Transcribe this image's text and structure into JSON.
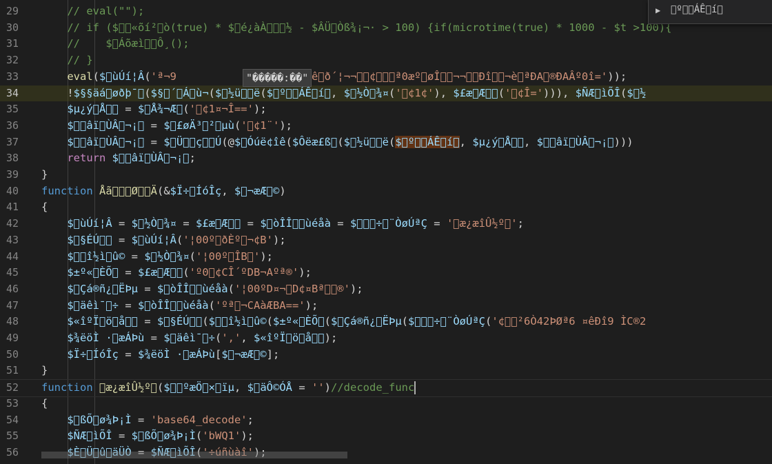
{
  "editor": {
    "lines": [
      {
        "n": "29",
        "segs": [
          {
            "c": "c-comment",
            "t": "    // eval(\"\");"
          }
        ]
      },
      {
        "n": "30",
        "segs": [
          {
            "c": "c-comment",
            "t": "    // if ($\u0000\u0000«õí²\u0000ò(true) * $\u0000é¿àÀ\u0000\u0000\u0000½ - $ÂÜ\u0000Òß¾¡¬· > 100) {if(microtime(true) * 1000 - $t >100){"
          }
        ]
      },
      {
        "n": "31",
        "segs": [
          {
            "c": "c-comment",
            "t": "    //    $\u0000Áõæì\u0000\u0000Ô¸();"
          }
        ]
      },
      {
        "n": "32",
        "segs": [
          {
            "c": "c-comment",
            "t": "    // }"
          }
        ]
      },
      {
        "n": "33",
        "segs": [
          {
            "c": "c-fn",
            "t": "    eval"
          },
          {
            "c": "c-plain",
            "t": "("
          },
          {
            "c": "c-var",
            "t": "$\u0000ùÚí¦Â"
          },
          {
            "c": "c-plain",
            "t": "("
          },
          {
            "c": "c-str",
            "t": "'ª¬9"
          },
          {
            "c": "c-str",
            "t": "               3B0ÈÔêê\u0000ð´¦¬¬\u0000\u0000¢\u0000\u0000\u0000ª0æº\u0000øÎ\u0000\u0000¬¬\u0000\u0000Ðî\u0000\u0000¬è\u0000ªÐA\u0000®ÐAÂº0î='"
          },
          {
            "c": "c-plain",
            "t": "));"
          }
        ]
      },
      {
        "n": "34",
        "segs": [
          {
            "c": "c-plain",
            "t": "    !"
          },
          {
            "c": "c-var",
            "t": "$§§äá\u0000øðþ¯\u0000"
          },
          {
            "c": "c-plain",
            "t": "("
          },
          {
            "c": "c-var",
            "t": "$§\u0000´\u0000Á\u0000ù¬"
          },
          {
            "c": "c-plain",
            "t": "("
          },
          {
            "c": "c-var",
            "t": "$\u0000½ü\u0000\u0000ë"
          },
          {
            "c": "c-plain",
            "t": "("
          },
          {
            "c": "c-var",
            "t": "$\u0000º\u0000\u0000ÁÊ\u0000í\u0000"
          },
          {
            "c": "c-plain",
            "t": ", "
          },
          {
            "c": "c-var",
            "t": "$\u0000½Ò\u0000¾¤"
          },
          {
            "c": "c-plain",
            "t": "("
          },
          {
            "c": "c-str",
            "t": "'\u0000¢1¢'"
          },
          {
            "c": "c-plain",
            "t": "), "
          },
          {
            "c": "c-var",
            "t": "$£æ\u0000Æ\u0000\u0000"
          },
          {
            "c": "c-plain",
            "t": "("
          },
          {
            "c": "c-str",
            "t": "'\u0000¢Î='"
          },
          {
            "c": "c-plain",
            "t": "))), "
          },
          {
            "c": "c-var",
            "t": "$ÑÆ\u0000ìÕÎ"
          },
          {
            "c": "c-plain",
            "t": "("
          },
          {
            "c": "c-var",
            "t": "$\u0000½"
          }
        ]
      },
      {
        "n": "35",
        "segs": [
          {
            "c": "c-var",
            "t": "    $µ¿ý\u0000Å\u0000\u0000"
          },
          {
            "c": "c-plain",
            "t": " = "
          },
          {
            "c": "c-var",
            "t": "$\u0000Å¾¬Æ\u0000"
          },
          {
            "c": "c-plain",
            "t": "("
          },
          {
            "c": "c-str",
            "t": "'\u0000¢1¤¬Î=='"
          },
          {
            "c": "c-plain",
            "t": ");"
          }
        ]
      },
      {
        "n": "36",
        "segs": [
          {
            "c": "c-var",
            "t": "    $\u0000\u0000âï\u0000ÙÂ\u0000¬¡\u0000"
          },
          {
            "c": "c-plain",
            "t": " = "
          },
          {
            "c": "c-var",
            "t": "$\u0000£øÄ³\u0000²\u0000µù"
          },
          {
            "c": "c-plain",
            "t": "("
          },
          {
            "c": "c-str",
            "t": "'\u0000¢1¨'"
          },
          {
            "c": "c-plain",
            "t": ");"
          }
        ]
      },
      {
        "n": "37",
        "segs": [
          {
            "c": "c-var",
            "t": "    $\u0000\u0000âï\u0000ÙÂ\u0000¬¡\u0000"
          },
          {
            "c": "c-plain",
            "t": " = "
          },
          {
            "c": "c-var",
            "t": "$\u0000Ü\u0000\u0000ç\u0000\u0000Ú"
          },
          {
            "c": "c-plain",
            "t": "(@"
          },
          {
            "c": "c-var",
            "t": "$\u0000Óúë¢îê"
          },
          {
            "c": "c-plain",
            "t": "("
          },
          {
            "c": "c-var",
            "t": "$Ôëæ£ß\u0000"
          },
          {
            "c": "c-plain",
            "t": "("
          },
          {
            "c": "c-var",
            "t": "$\u0000½ü\u0000\u0000ë"
          },
          {
            "c": "c-plain",
            "t": "("
          },
          {
            "c": "c-var sel-box",
            "t": "$\u0000º\u0000\u0000ÁÊ\u0000í\u0000"
          },
          {
            "c": "c-plain",
            "t": ", "
          },
          {
            "c": "c-var",
            "t": "$µ¿ý\u0000Å\u0000\u0000"
          },
          {
            "c": "c-plain",
            "t": ", "
          },
          {
            "c": "c-var",
            "t": "$\u0000\u0000âï\u0000ÙÂ\u0000¬¡\u0000"
          },
          {
            "c": "c-plain",
            "t": ")))"
          }
        ]
      },
      {
        "n": "38",
        "segs": [
          {
            "c": "c-ctrl",
            "t": "    return "
          },
          {
            "c": "c-var",
            "t": "$\u0000\u0000âï\u0000ÙÂ\u0000¬¡\u0000"
          },
          {
            "c": "c-plain",
            "t": ";"
          }
        ]
      },
      {
        "n": "39",
        "segs": [
          {
            "c": "c-plain",
            "t": "}"
          }
        ]
      },
      {
        "n": "40",
        "segs": [
          {
            "c": "c-kw",
            "t": "function "
          },
          {
            "c": "c-fn",
            "t": "Åã\u0000\u0000\u0000Ø\u0000\u0000Ä"
          },
          {
            "c": "c-plain",
            "t": "(&"
          },
          {
            "c": "c-var",
            "t": "$Ï÷\u0000ÍóÎç"
          },
          {
            "c": "c-plain",
            "t": ", "
          },
          {
            "c": "c-var",
            "t": "$\u0000¬æÆ\u0000©"
          },
          {
            "c": "c-plain",
            "t": ")"
          }
        ]
      },
      {
        "n": "41",
        "segs": [
          {
            "c": "c-plain",
            "t": "{"
          }
        ]
      },
      {
        "n": "42",
        "segs": [
          {
            "c": "c-var",
            "t": "    $\u0000ùÚí¦Â"
          },
          {
            "c": "c-plain",
            "t": " = "
          },
          {
            "c": "c-var",
            "t": "$\u0000½Ò\u0000¾¤"
          },
          {
            "c": "c-plain",
            "t": " = "
          },
          {
            "c": "c-var",
            "t": "$£æ\u0000Æ\u0000\u0000"
          },
          {
            "c": "c-plain",
            "t": " = "
          },
          {
            "c": "c-var",
            "t": "$\u0000òÎÎ\u0000\u0000ùéåà"
          },
          {
            "c": "c-plain",
            "t": " = "
          },
          {
            "c": "c-var",
            "t": "$\u0000\u0000\u0000÷\u0000¨ÒøÚªÇ"
          },
          {
            "c": "c-plain",
            "t": " = "
          },
          {
            "c": "c-str",
            "t": "'\u0000æ¿æîÛ½º\u0000'"
          },
          {
            "c": "c-plain",
            "t": ";"
          }
        ]
      },
      {
        "n": "43",
        "segs": [
          {
            "c": "c-var",
            "t": "    $\u0000§ÉÚ\u0000\u0000"
          },
          {
            "c": "c-plain",
            "t": " = "
          },
          {
            "c": "c-var",
            "t": "$\u0000ùÚí¦Â"
          },
          {
            "c": "c-plain",
            "t": "("
          },
          {
            "c": "c-str",
            "t": "'¦00º\u0000ðÈº\u0000¬¢B'"
          },
          {
            "c": "c-plain",
            "t": ");"
          }
        ]
      },
      {
        "n": "44",
        "segs": [
          {
            "c": "c-var",
            "t": "    $\u0000\u0000î½ì\u0000û©"
          },
          {
            "c": "c-plain",
            "t": " = "
          },
          {
            "c": "c-var",
            "t": "$\u0000½Ò\u0000¾¤"
          },
          {
            "c": "c-plain",
            "t": "("
          },
          {
            "c": "c-str",
            "t": "'¦00º\u0000ÎB\u0000'"
          },
          {
            "c": "c-plain",
            "t": ");"
          }
        ]
      },
      {
        "n": "45",
        "segs": [
          {
            "c": "c-var",
            "t": "    $±º«\u0000ÈÕ\u0000"
          },
          {
            "c": "c-plain",
            "t": " = "
          },
          {
            "c": "c-var",
            "t": "$£æ\u0000Æ\u0000\u0000"
          },
          {
            "c": "c-plain",
            "t": "("
          },
          {
            "c": "c-str",
            "t": "'º0\u0000¢CÎ´ºDB¬Aºª®'"
          },
          {
            "c": "c-plain",
            "t": ");"
          }
        ]
      },
      {
        "n": "46",
        "segs": [
          {
            "c": "c-var",
            "t": "    $\u0000Çá®ñ¿\u0000ËÞµ"
          },
          {
            "c": "c-plain",
            "t": " = "
          },
          {
            "c": "c-var",
            "t": "$\u0000òÎÎ\u0000\u0000ùéåà"
          },
          {
            "c": "c-plain",
            "t": "("
          },
          {
            "c": "c-str",
            "t": "'¦00ºD¤¬\u0000D¢¤Bª\u0000\u0000®'"
          },
          {
            "c": "c-plain",
            "t": ");"
          }
        ]
      },
      {
        "n": "47",
        "segs": [
          {
            "c": "c-var",
            "t": "    $\u0000äêì¯\u0000÷"
          },
          {
            "c": "c-plain",
            "t": " = "
          },
          {
            "c": "c-var",
            "t": "$\u0000òÎÎ\u0000\u0000ùéåà"
          },
          {
            "c": "c-plain",
            "t": "("
          },
          {
            "c": "c-str",
            "t": "'ºª\u0000¬CAàÆBA=='"
          },
          {
            "c": "c-plain",
            "t": ");"
          }
        ]
      },
      {
        "n": "48",
        "segs": [
          {
            "c": "c-var",
            "t": "    $«îºÏ\u0000ö\u0000å\u0000\u0000"
          },
          {
            "c": "c-plain",
            "t": " = "
          },
          {
            "c": "c-var",
            "t": "$\u0000§ÉÚ\u0000\u0000"
          },
          {
            "c": "c-plain",
            "t": "("
          },
          {
            "c": "c-var",
            "t": "$\u0000\u0000î½ì\u0000û©"
          },
          {
            "c": "c-plain",
            "t": "("
          },
          {
            "c": "c-var",
            "t": "$±º«\u0000ÈÕ\u0000"
          },
          {
            "c": "c-plain",
            "t": "("
          },
          {
            "c": "c-var",
            "t": "$\u0000Çá®ñ¿\u0000ËÞµ"
          },
          {
            "c": "c-plain",
            "t": "("
          },
          {
            "c": "c-var",
            "t": "$\u0000\u0000\u0000÷\u0000¨ÒøÚªÇ"
          },
          {
            "c": "c-plain",
            "t": "("
          },
          {
            "c": "c-str",
            "t": "'¢\u0000\u0000²6Ò42ÞØª6 ¤êÐî9 ÌC®2"
          }
        ]
      },
      {
        "n": "49",
        "segs": [
          {
            "c": "c-var",
            "t": "    $¾ëöÌ ·\u0000æÁÞù"
          },
          {
            "c": "c-plain",
            "t": " = "
          },
          {
            "c": "c-var",
            "t": "$\u0000äêì¯\u0000÷"
          },
          {
            "c": "c-plain",
            "t": "("
          },
          {
            "c": "c-str",
            "t": "','"
          },
          {
            "c": "c-plain",
            "t": ", "
          },
          {
            "c": "c-var",
            "t": "$«îºÏ\u0000ö\u0000å\u0000\u0000"
          },
          {
            "c": "c-plain",
            "t": ");"
          }
        ]
      },
      {
        "n": "50",
        "segs": [
          {
            "c": "c-var",
            "t": "    $Ï÷\u0000ÍóÎç"
          },
          {
            "c": "c-plain",
            "t": " = "
          },
          {
            "c": "c-var",
            "t": "$¾ëöÌ ·\u0000æÁÞù"
          },
          {
            "c": "c-plain",
            "t": "["
          },
          {
            "c": "c-var",
            "t": "$\u0000¬æÆ\u0000©"
          },
          {
            "c": "c-plain",
            "t": "];"
          }
        ]
      },
      {
        "n": "51",
        "segs": [
          {
            "c": "c-plain",
            "t": "}"
          }
        ]
      },
      {
        "n": "52",
        "segs": [
          {
            "c": "c-kw",
            "t": "function "
          },
          {
            "c": "c-fn",
            "t": "\u0000æ¿æîÛ½º\u0000"
          },
          {
            "c": "c-plain",
            "t": "("
          },
          {
            "c": "c-var",
            "t": "$\u0000\u0000ºæÖ\u0000×\u0000ïµ"
          },
          {
            "c": "c-plain",
            "t": ", "
          },
          {
            "c": "c-var",
            "t": "$\u0000äÔ©ÓÅ"
          },
          {
            "c": "c-plain",
            "t": " = "
          },
          {
            "c": "c-str",
            "t": "''"
          },
          {
            "c": "c-plain",
            "t": ")"
          },
          {
            "c": "c-comment",
            "t": "//decode_func"
          }
        ]
      },
      {
        "n": "53",
        "segs": [
          {
            "c": "c-plain",
            "t": "{"
          }
        ]
      },
      {
        "n": "54",
        "segs": [
          {
            "c": "c-var",
            "t": "    $\u0000ßÕ\u0000ø¾Þ¡Ì"
          },
          {
            "c": "c-plain",
            "t": " = "
          },
          {
            "c": "c-str",
            "t": "'base64_decode'"
          },
          {
            "c": "c-plain",
            "t": ";"
          }
        ]
      },
      {
        "n": "55",
        "segs": [
          {
            "c": "c-var",
            "t": "    $ÑÆ\u0000ìÕÎ"
          },
          {
            "c": "c-plain",
            "t": " = "
          },
          {
            "c": "c-var",
            "t": "$\u0000ßÕ\u0000ø¾Þ¡Ì"
          },
          {
            "c": "c-plain",
            "t": "("
          },
          {
            "c": "c-str",
            "t": "'bWQ1'"
          },
          {
            "c": "c-plain",
            "t": ");"
          }
        ]
      },
      {
        "n": "56",
        "segs": [
          {
            "c": "c-var",
            "t": "    $È\u0000Ü\u0000û\u0000äÜÒ"
          },
          {
            "c": "c-plain",
            "t": " = "
          },
          {
            "c": "c-var",
            "t": "$ÑÆ\u0000ìÕÎ"
          },
          {
            "c": "c-plain",
            "t": "("
          },
          {
            "c": "c-str",
            "t": "'÷úñùàî'"
          },
          {
            "c": "c-plain",
            "t": ");"
          }
        ]
      }
    ],
    "tooltip_text": "\"�����:��\"",
    "find_widget": {
      "chevron": "▶",
      "text": "\u0000º\u0000\u0000ÁÊ\u0000í\u0000"
    }
  },
  "colors": {
    "background": "#1e1e1e",
    "comment": "#6a9955",
    "variable": "#9cdcfe",
    "function": "#dcdcaa",
    "keyword": "#569cd6",
    "string": "#ce9178"
  }
}
